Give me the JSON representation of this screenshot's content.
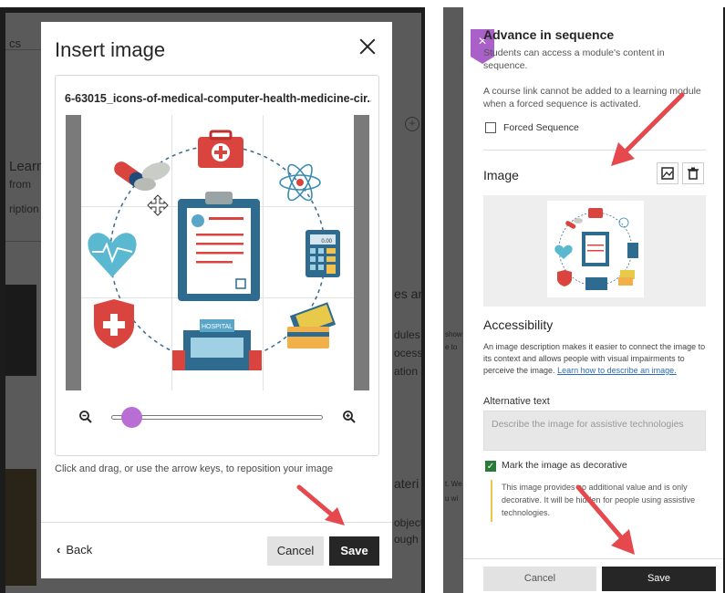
{
  "left_modal": {
    "title": "Insert image",
    "close_icon": "close-icon",
    "file_name": "6-63015_icons-of-medical-computer-health-medicine-cir...",
    "zoom_level": 0.1,
    "helper_text": "Click and drag, or use the arrow keys, to reposition your image",
    "back_label": "Back",
    "cancel_label": "Cancel",
    "save_label": "Save",
    "image_text": "HOSPITAL",
    "calculator_text": "0.00"
  },
  "background_page": {
    "fragments": [
      "cs",
      "Learn",
      "from",
      "ription",
      "es and",
      "dules",
      "ocess",
      "ation a",
      "ateri",
      "object",
      "ough",
      "t. We",
      "u wi"
    ]
  },
  "right_panel": {
    "close_icon": "close-icon",
    "sequence_title": "Advance in sequence",
    "sequence_desc": "Students can access a module's content in sequence.",
    "course_link_note": "A course link cannot be added to a learning module when a forced sequence is activated.",
    "forced_sequence_label": "Forced Sequence",
    "forced_sequence_checked": false,
    "image_heading": "Image",
    "accessibility_heading": "Accessibility",
    "accessibility_desc": "An image description makes it easier to connect the image to its context and allows people with visual impairments to perceive the image.",
    "learn_link": "Learn how to describe an image.",
    "alt_text_label": "Alternative text",
    "alt_text_placeholder": "Describe the image for assistive technologies",
    "decorative_label": "Mark the image as decorative",
    "decorative_checked": true,
    "decorative_note": "This image provides no additional value and is only decorative. It will be hidden for people using assistive technologies.",
    "cancel_label": "Cancel",
    "save_label": "Save",
    "bg_fragments": [
      "show",
      "e to"
    ]
  },
  "colors": {
    "accent_purple": "#b86ed2",
    "dark_button": "#262626",
    "annotation_arrow": "#e5484d",
    "check_green": "#2a7a3a"
  }
}
